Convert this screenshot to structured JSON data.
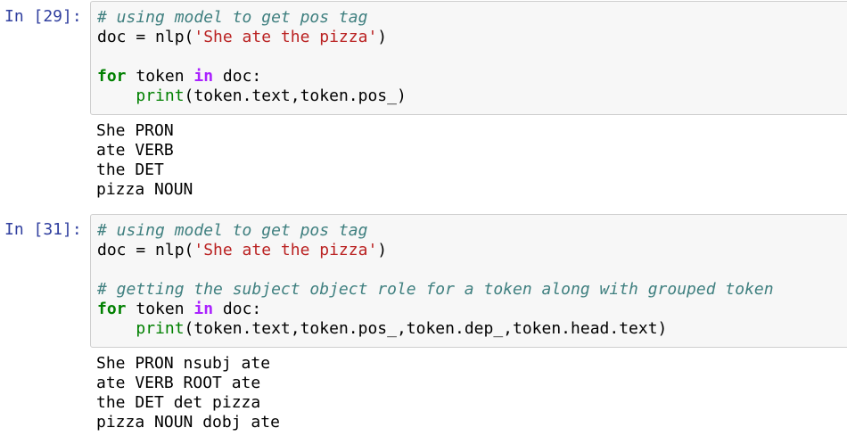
{
  "cells": [
    {
      "prompt": "In [29]:",
      "code": {
        "line1_comment": "# using model to get pos tag",
        "line2_pre": "doc = nlp(",
        "line2_string": "'She ate the pizza'",
        "line2_post": ")",
        "line4_kw_for": "for",
        "line4_mid": " token ",
        "line4_kw_in": "in",
        "line4_post": " doc:",
        "line5_indent": "    ",
        "line5_builtin": "print",
        "line5_rest": "(token.text,token.pos_)"
      },
      "output": [
        "She PRON",
        "ate VERB",
        "the DET",
        "pizza NOUN"
      ]
    },
    {
      "prompt": "In [31]:",
      "code": {
        "line1_comment": "# using model to get pos tag",
        "line2_pre": "doc = nlp(",
        "line2_string": "'She ate the pizza'",
        "line2_post": ")",
        "line4_comment": "# getting the subject object role for a token along with grouped token",
        "line5_kw_for": "for",
        "line5_mid": " token ",
        "line5_kw_in": "in",
        "line5_post": " doc:",
        "line6_indent": "    ",
        "line6_builtin": "print",
        "line6_rest": "(token.text,token.pos_,token.dep_,token.head.text)"
      },
      "output": [
        "She PRON nsubj ate",
        "ate VERB ROOT ate",
        "the DET det pizza",
        "pizza NOUN dobj ate"
      ]
    }
  ],
  "colors": {
    "prompt": "#303f9f",
    "comment": "#408080",
    "keyword": "#008000",
    "operator_word": "#aa22ff",
    "string": "#ba2121",
    "input_background": "#f7f7f7",
    "input_border": "#cfcfcf"
  }
}
